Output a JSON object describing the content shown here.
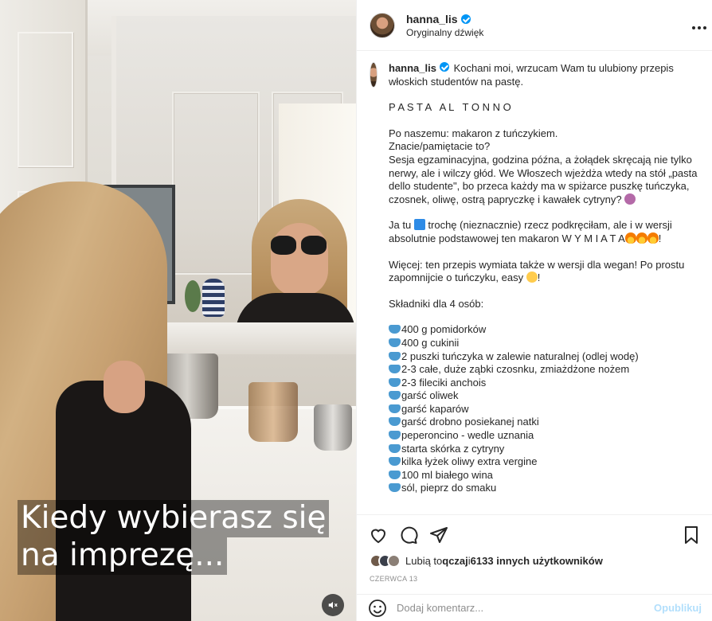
{
  "media": {
    "caption_line1": "Kiedy wybierasz się",
    "caption_line2": "na imprezę..."
  },
  "header": {
    "username": "hanna_lis",
    "subtitle": "Oryginalny dźwięk",
    "more_icon": "ellipsis-icon"
  },
  "post": {
    "username": "hanna_lis",
    "intro": " Kochani moi, wrzucam Wam tu ulubiony przepis włoskich studentów na pastę.",
    "title": "P A S T A   A L   T O N N O",
    "para1_a": "Po naszemu: makaron z tuńczykiem.",
    "para1_b": "Znacie/pamiętacie to?",
    "para1_c": "Sesja egzaminacyjna, godzina późna, a żołądek skręcają nie tylko nerwy, ale i wilczy głód. We Włoszech wjeżdża wtedy na stół „pasta dello studente\", bo przeca każdy ma w spiżarce puszkę tuńczyka, czosnek, oliwę, ostrą papryczkę i kawałek cytryny? ",
    "para2_a": "Ja tu ",
    "para2_b": " trochę (nieznacznie) rzecz podkręciłam, ale i w wersji absolutnie podstawowej ten makaron W Y M I A T A",
    "para2_c": "!",
    "para3_a": "Więcej: ten przepis wymiata także w wersji dla wegan! Po prostu zapomnijcie o tuńczyku, easy ",
    "para3_b": "!",
    "ingredients_title": "Składniki dla 4 osób:",
    "ingredients": [
      "400 g pomidorków",
      "400 g cukinii",
      "2 puszki tuńczyka w zalewie naturalnej (odlej wodę)",
      "2-3 całe, duże ząbki czosnku, zmiażdżone nożem",
      "2-3 fileciki anchois",
      "garść oliwek",
      "garść kaparów",
      "garść drobno posiekanej natki",
      "peperoncino - wedle uznania",
      "starta skórka z cytryny",
      "kilka łyżek oliwy extra vergine",
      "100 ml białego wina",
      "sól, pieprz do smaku"
    ]
  },
  "actions": {
    "like_icon": "heart-icon",
    "comment_icon": "comment-icon",
    "share_icon": "send-icon",
    "save_icon": "bookmark-icon"
  },
  "likes": {
    "prefix": "Lubią to ",
    "user": "qczaj",
    "middle": " i ",
    "count": "6133 innych użytkowników"
  },
  "date": "CZERWCA 13",
  "comment": {
    "placeholder": "Dodaj komentarz...",
    "post_label": "Opublikuj"
  },
  "colors": {
    "verified": "#0095f6",
    "post_button": "#b2dffc",
    "muted_text": "#8e8e8e"
  }
}
